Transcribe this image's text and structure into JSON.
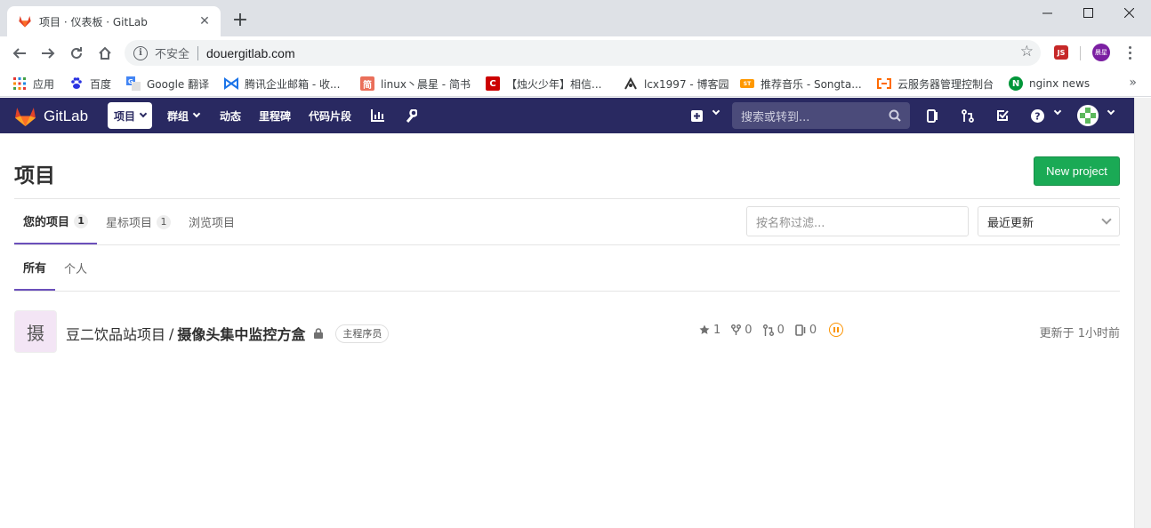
{
  "browser": {
    "tab_title": "项目 · 仪表板 · GitLab",
    "insecure_label": "不安全",
    "url": "douergitlab.com",
    "profile_label": "晨星",
    "ext_label": "JS"
  },
  "bookmarks": [
    {
      "label": "应用",
      "icon": "apps-grid-icon"
    },
    {
      "label": "百度",
      "icon": "baidu-paw-icon"
    },
    {
      "label": "Google 翻译",
      "icon": "google-translate-icon"
    },
    {
      "label": "腾讯企业邮箱 - 收...",
      "icon": "tencent-mail-icon"
    },
    {
      "label": "linux丶晨星 - 简书",
      "icon": "jianshu-icon",
      "icon_text": "简"
    },
    {
      "label": "【烛火少年】相信...",
      "icon": "csdn-icon",
      "icon_text": "C"
    },
    {
      "label": "lcx1997 - 博客园",
      "icon": "cnblogs-icon"
    },
    {
      "label": "推荐音乐 - Songta...",
      "icon": "songtaste-icon"
    },
    {
      "label": "云服务器管理控制台",
      "icon": "aliyun-icon"
    },
    {
      "label": "nginx news",
      "icon": "nginx-icon",
      "icon_text": "N"
    }
  ],
  "gitlab_nav": {
    "brand": "GitLab",
    "items": [
      "项目",
      "群组",
      "动态",
      "里程碑",
      "代码片段"
    ],
    "search_placeholder": "搜索或转到..."
  },
  "page": {
    "title": "项目",
    "new_project_label": "New project",
    "tabs": [
      {
        "label": "您的项目",
        "count": "1"
      },
      {
        "label": "星标项目",
        "count": "1"
      },
      {
        "label": "浏览项目",
        "count": ""
      }
    ],
    "filter_placeholder": "按名称过滤...",
    "sort_selected": "最近更新",
    "subtabs": [
      "所有",
      "个人"
    ]
  },
  "projects": [
    {
      "avatar_letter": "摄",
      "namespace": "豆二饮品站项目",
      "name": "摄像头集中监控方盒",
      "role": "主程序员",
      "stars": "1",
      "forks": "0",
      "merge_requests": "0",
      "issues": "0",
      "updated": "更新于 1小时前"
    }
  ],
  "colors": {
    "nav_bg": "#292961",
    "accent_tab": "#6b4fbb",
    "new_project_bg": "#1aaa55",
    "pipeline_status": "#fc9403"
  }
}
